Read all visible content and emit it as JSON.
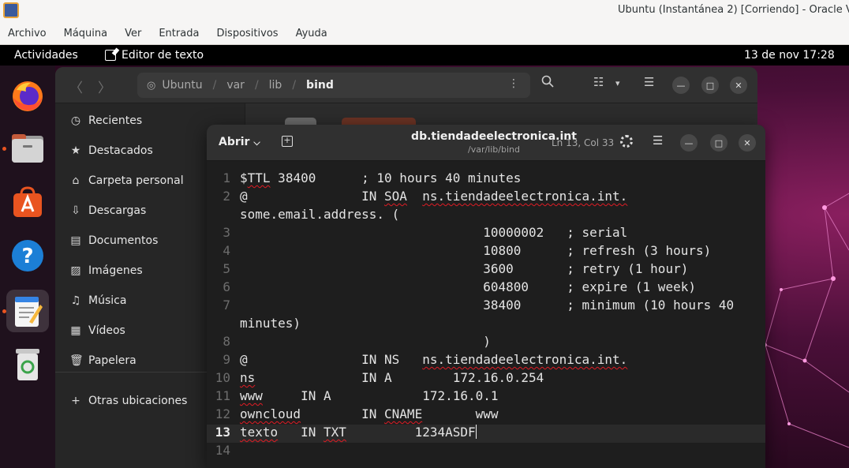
{
  "vbox": {
    "title": "Ubuntu (Instantánea 2) [Corriendo] - Oracle VM V",
    "menu": [
      "Archivo",
      "Máquina",
      "Ver",
      "Entrada",
      "Dispositivos",
      "Ayuda"
    ]
  },
  "topbar": {
    "activities": "Actividades",
    "app_name": "Editor de texto",
    "clock": "13 de nov  17:28"
  },
  "dock": [
    "firefox-icon",
    "files-icon",
    "app-center-icon",
    "help-icon",
    "text-editor-icon",
    "trash-icon"
  ],
  "files": {
    "path": [
      "Ubuntu",
      "var",
      "lib",
      "bind"
    ],
    "sidebar": [
      {
        "icon": "clock-icon",
        "label": "Recientes"
      },
      {
        "icon": "star-icon",
        "label": "Destacados"
      },
      {
        "icon": "home-icon",
        "label": "Carpeta personal"
      },
      {
        "icon": "download-icon",
        "label": "Descargas"
      },
      {
        "icon": "document-icon",
        "label": "Documentos"
      },
      {
        "icon": "image-icon",
        "label": "Imágenes"
      },
      {
        "icon": "music-icon",
        "label": "Música"
      },
      {
        "icon": "video-icon",
        "label": "Vídeos"
      },
      {
        "icon": "trash-icon",
        "label": "Papelera"
      },
      {
        "icon": "plus-icon",
        "label": "Otras ubicaciones"
      }
    ]
  },
  "editor": {
    "open_label": "Abrir",
    "title": "db.tiendadeelectronica.int",
    "path": "/var/lib/bind",
    "cursor_position": "Ln 13, Col 33",
    "current_line": 13,
    "lines": [
      {
        "n": "1",
        "segments": [
          {
            "t": "$"
          },
          {
            "t": "TTL",
            "err": true
          },
          {
            "t": " 38400      ; 10 hours 40 minutes"
          }
        ]
      },
      {
        "n": "2",
        "segments": [
          {
            "t": "@               IN "
          },
          {
            "t": "SOA",
            "err": true
          },
          {
            "t": "  "
          },
          {
            "t": "ns.tiendadeelectronica.int.",
            "err": true
          }
        ]
      },
      {
        "n": "",
        "segments": [
          {
            "t": "some.email.address. ("
          }
        ]
      },
      {
        "n": "3",
        "segments": [
          {
            "t": "                                10000002   ; serial"
          }
        ]
      },
      {
        "n": "4",
        "segments": [
          {
            "t": "                                10800      ; refresh (3 hours)"
          }
        ]
      },
      {
        "n": "5",
        "segments": [
          {
            "t": "                                3600       ; retry (1 hour)"
          }
        ]
      },
      {
        "n": "6",
        "segments": [
          {
            "t": "                                604800     ; expire (1 week)"
          }
        ]
      },
      {
        "n": "7",
        "segments": [
          {
            "t": "                                38400      ; minimum (10 hours 40"
          }
        ]
      },
      {
        "n": "",
        "segments": [
          {
            "t": "minutes)"
          }
        ]
      },
      {
        "n": "8",
        "segments": [
          {
            "t": "                                )"
          }
        ]
      },
      {
        "n": "9",
        "segments": [
          {
            "t": "@               IN NS   "
          },
          {
            "t": "ns.tiendadeelectronica.int.",
            "err": true
          }
        ]
      },
      {
        "n": "10",
        "segments": [
          {
            "t": "ns",
            "err": true
          },
          {
            "t": "              IN A        172.16.0.254"
          }
        ]
      },
      {
        "n": "11",
        "segments": [
          {
            "t": "www",
            "err": true
          },
          {
            "t": "     IN A            172.16.0.1"
          }
        ]
      },
      {
        "n": "12",
        "segments": [
          {
            "t": "owncloud",
            "err": true
          },
          {
            "t": "        IN "
          },
          {
            "t": "CNAME",
            "err": true
          },
          {
            "t": "       www"
          }
        ]
      },
      {
        "n": "13",
        "segments": [
          {
            "t": "texto",
            "err": true
          },
          {
            "t": "   IN "
          },
          {
            "t": "TXT",
            "err": true
          },
          {
            "t": "         1234ASDF"
          }
        ],
        "caret": true
      },
      {
        "n": "14",
        "segments": []
      }
    ]
  }
}
